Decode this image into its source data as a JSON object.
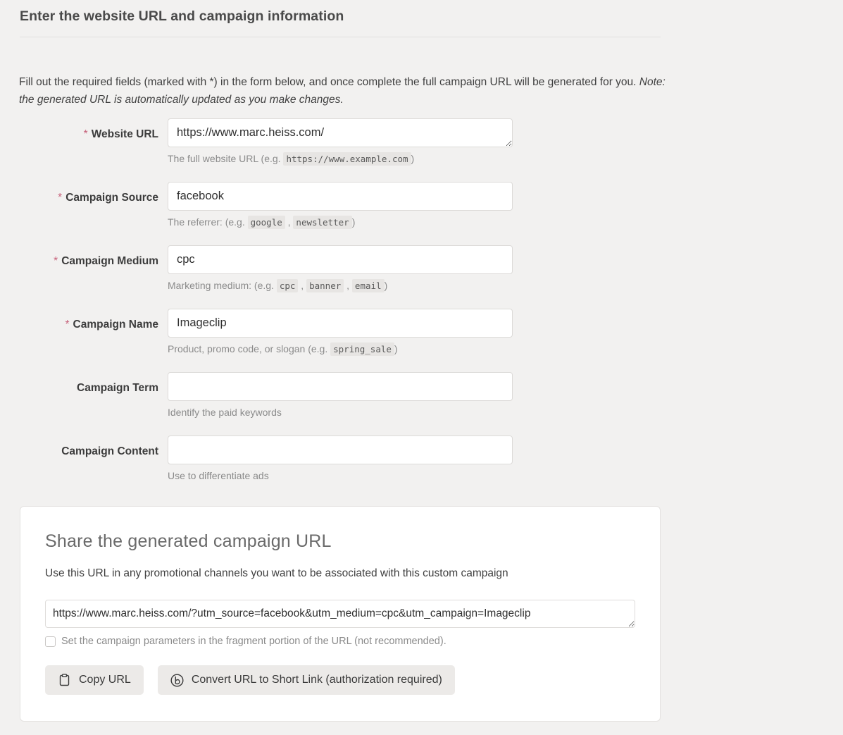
{
  "section": {
    "heading": "Enter the website URL and campaign information",
    "intro_text": "Fill out the required fields (marked with *) in the form below, and once complete the full campaign URL will be generated for you. ",
    "intro_note": "Note: the generated URL is automatically updated as you make changes."
  },
  "form": {
    "required_marker": "*",
    "fields": [
      {
        "label": "Website URL",
        "required": true,
        "value": "https://www.marc.heiss.com/",
        "hint_prefix": "The full website URL (e.g. ",
        "hint_codes": [
          "https://www.example.com"
        ],
        "hint_suffix": ")"
      },
      {
        "label": "Campaign Source",
        "required": true,
        "value": "facebook",
        "hint_prefix": "The referrer: (e.g. ",
        "hint_codes": [
          "google",
          "newsletter"
        ],
        "hint_suffix": ")"
      },
      {
        "label": "Campaign Medium",
        "required": true,
        "value": "cpc",
        "hint_prefix": "Marketing medium: (e.g. ",
        "hint_codes": [
          "cpc",
          "banner",
          "email"
        ],
        "hint_suffix": ")"
      },
      {
        "label": "Campaign Name",
        "required": true,
        "value": "Imageclip",
        "hint_prefix": "Product, promo code, or slogan (e.g. ",
        "hint_codes": [
          "spring_sale"
        ],
        "hint_suffix": ")"
      },
      {
        "label": "Campaign Term",
        "required": false,
        "value": "",
        "hint_prefix": "Identify the paid keywords",
        "hint_codes": [],
        "hint_suffix": ""
      },
      {
        "label": "Campaign Content",
        "required": false,
        "value": "",
        "hint_prefix": "Use to differentiate ads",
        "hint_codes": [],
        "hint_suffix": ""
      }
    ]
  },
  "share": {
    "title": "Share the generated campaign URL",
    "subtitle": "Use this URL in any promotional channels you want to be associated with this custom campaign",
    "generated_url": "https://www.marc.heiss.com/?utm_source=facebook&utm_medium=cpc&utm_campaign=Imageclip",
    "fragment_checkbox_label": "Set the campaign parameters in the fragment portion of the URL (not recommended).",
    "fragment_checked": false,
    "copy_button_label": "Copy URL",
    "copy_button_icon": "clipboard-icon",
    "shorten_button_label": "Convert URL to Short Link (authorization required)",
    "shorten_button_icon": "bitly-icon"
  },
  "colors": {
    "page_background": "#f2f1f0",
    "required_star": "#c7627b",
    "card_background": "#ffffff",
    "card_border": "#e4e2e0",
    "button_background": "#eceae8",
    "hint_text": "#8b8b8b",
    "body_text": "#3c3c3c"
  }
}
